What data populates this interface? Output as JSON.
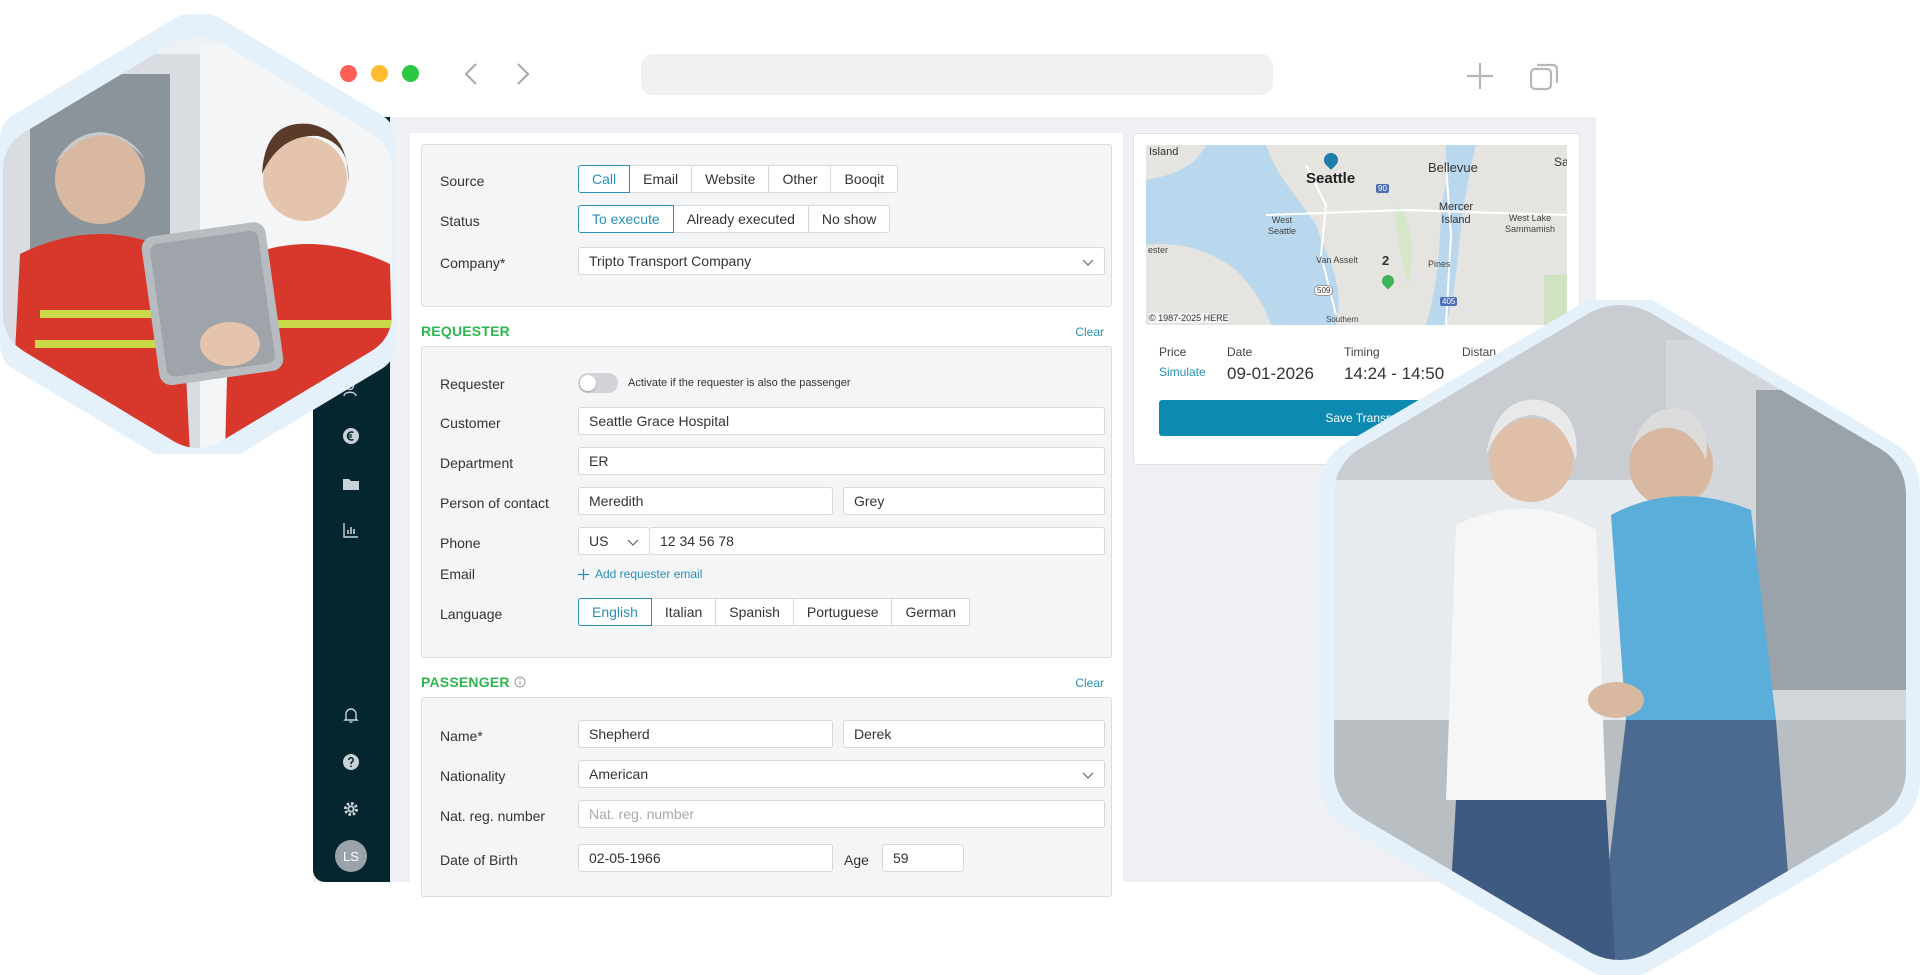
{
  "form": {
    "source": {
      "label": "Source",
      "options": [
        "Call",
        "Email",
        "Website",
        "Other",
        "Booqit"
      ],
      "selected": "Call"
    },
    "status": {
      "label": "Status",
      "options": [
        "To execute",
        "Already executed",
        "No show"
      ],
      "selected": "To execute"
    },
    "company": {
      "label": "Company*",
      "value": "Tripto Transport Company"
    },
    "requester": {
      "title": "REQUESTER",
      "clear_label": "Clear",
      "toggle_label": "Requester",
      "toggle_hint": "Activate if the requester is also the passenger",
      "customer_label": "Customer",
      "customer_value": "Seattle Grace Hospital",
      "department_label": "Department",
      "department_value": "ER",
      "contact_label": "Person of contact",
      "contact_first": "Meredith",
      "contact_last": "Grey",
      "phone_label": "Phone",
      "phone_country": "US",
      "phone_number": "12 34 56 78",
      "email_label": "Email",
      "add_email_label": "Add requester email",
      "language_label": "Language",
      "languages": [
        "English",
        "Italian",
        "Spanish",
        "Portuguese",
        "German"
      ],
      "language_selected": "English"
    },
    "passenger": {
      "title": "PASSENGER",
      "clear_label": "Clear",
      "name_label": "Name*",
      "last_name": "Shepherd",
      "first_name": "Derek",
      "nationality_label": "Nationality",
      "nationality_value": "American",
      "natreg_label": "Nat. reg. number",
      "natreg_placeholder": "Nat. reg. number",
      "dob_label": "Date of Birth",
      "dob_value": "02-05-1966",
      "age_label": "Age",
      "age_value": "59"
    }
  },
  "summary": {
    "price_label": "Price",
    "price_action": "Simulate",
    "date_label": "Date",
    "date_value": "09-01-2026",
    "timing_label": "Timing",
    "timing_value": "14:24 - 14:50",
    "distance_label": "Distan",
    "save_label": "Save Transp"
  },
  "map": {
    "labels": [
      "Island",
      "Seattle",
      "Bellevue",
      "Sa",
      "Mercer Island",
      "West Seattle",
      "West Lake Sammamish",
      "Van Asselt",
      "Pines",
      "ester",
      "2",
      "© 1987-2025 HERE",
      "Southern"
    ],
    "highways": [
      "90",
      "405",
      "509"
    ],
    "copyright": "© 1987-2025 HERE"
  },
  "user": {
    "initials": "LS"
  },
  "colors": {
    "accent": "#2a8fb6",
    "section_green": "#2db54f",
    "sidebar": "#06262f",
    "save_button": "#0d8ab2"
  }
}
